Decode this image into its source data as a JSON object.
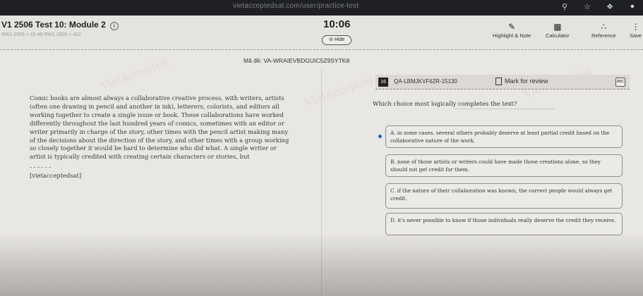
{
  "browser": {
    "url": "vietacceptedsat.com/user/practice-test",
    "icons": [
      "search-icon",
      "star-icon",
      "extension-icon",
      "profile-icon"
    ]
  },
  "header": {
    "title": "V1 2506 Test 10: Module 2",
    "breadcrumb": "RW1 2506 > 10 48 RW1 2506 > 401",
    "timer": "10:06",
    "hide_label": "Hide",
    "tools": [
      {
        "label": "Highlight & Note",
        "icon": "pen-icon"
      },
      {
        "label": "Calculator",
        "icon": "calculator-icon"
      },
      {
        "label": "Reference",
        "icon": "reference-icon"
      },
      {
        "label": "Save",
        "icon": "more-icon"
      }
    ]
  },
  "exam_code": "Mã đề: VA-WRAIEVBDGUIC5Z9SYTK8",
  "passage": {
    "text": "Comic books are almost always a collaborative creative process, with writers, artists (often one drawing in pencil and another in ink), letterers, colorists, and editors all working together to create a single issue or book. These collaborations have worked differently throughout the last hundred years of comics, sometimes with an editor or writer primarily in charge of the story, other times with the pencil artist making many of the decisions about the direction of the story, and other times with a group working so closely together it would be hard to determine who did what. A single writer or artist is typically credited with creating certain characters or stories, but",
    "source": "[vietacceptedsat]"
  },
  "question": {
    "number": "16",
    "id": "QA-LBMJKVF62R-15130",
    "mark_label": "Mark for review",
    "stem": "Which choice most logically completes the text?",
    "options": [
      {
        "text": "A. in some cases, several others probably deserve at least partial credit based on the collaborative nature of the work.",
        "selected": true
      },
      {
        "text": "B. none of those artists or writers could have made those creations alone, so they should not get credit for them.",
        "selected": false
      },
      {
        "text": "C. if the nature of their collaboration was known, the correct people would always get credit.",
        "selected": false
      },
      {
        "text": "D. it's never possible to know if those individuals really deserve the credit they receive.",
        "selected": false
      }
    ]
  },
  "colors": {
    "selected_radio": "#1b5fd6",
    "number_badge": "#222222"
  }
}
